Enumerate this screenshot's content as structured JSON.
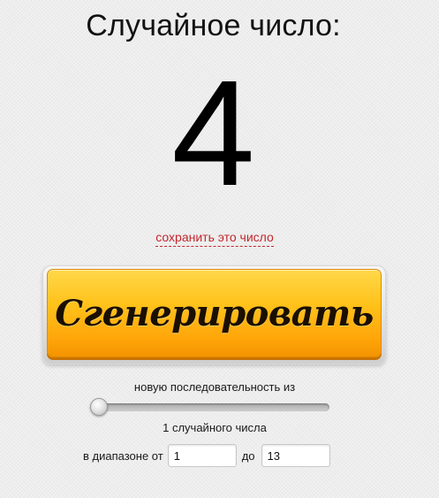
{
  "header": {
    "title": "Случайное число:"
  },
  "result": {
    "value": "4"
  },
  "save": {
    "link_label": "сохранить это число"
  },
  "generate": {
    "button_label": "Сгенерировать"
  },
  "sequence": {
    "label": "новую последовательность из",
    "slider_fraction": 0,
    "count_label": "1 случайного числа"
  },
  "range": {
    "from_label": "в диапазоне от",
    "from_value": "1",
    "to_label": "до",
    "to_value": "13"
  },
  "colors": {
    "accent_orange": "#ffa50a",
    "link_red": "#c2272d",
    "background": "#ededed"
  }
}
